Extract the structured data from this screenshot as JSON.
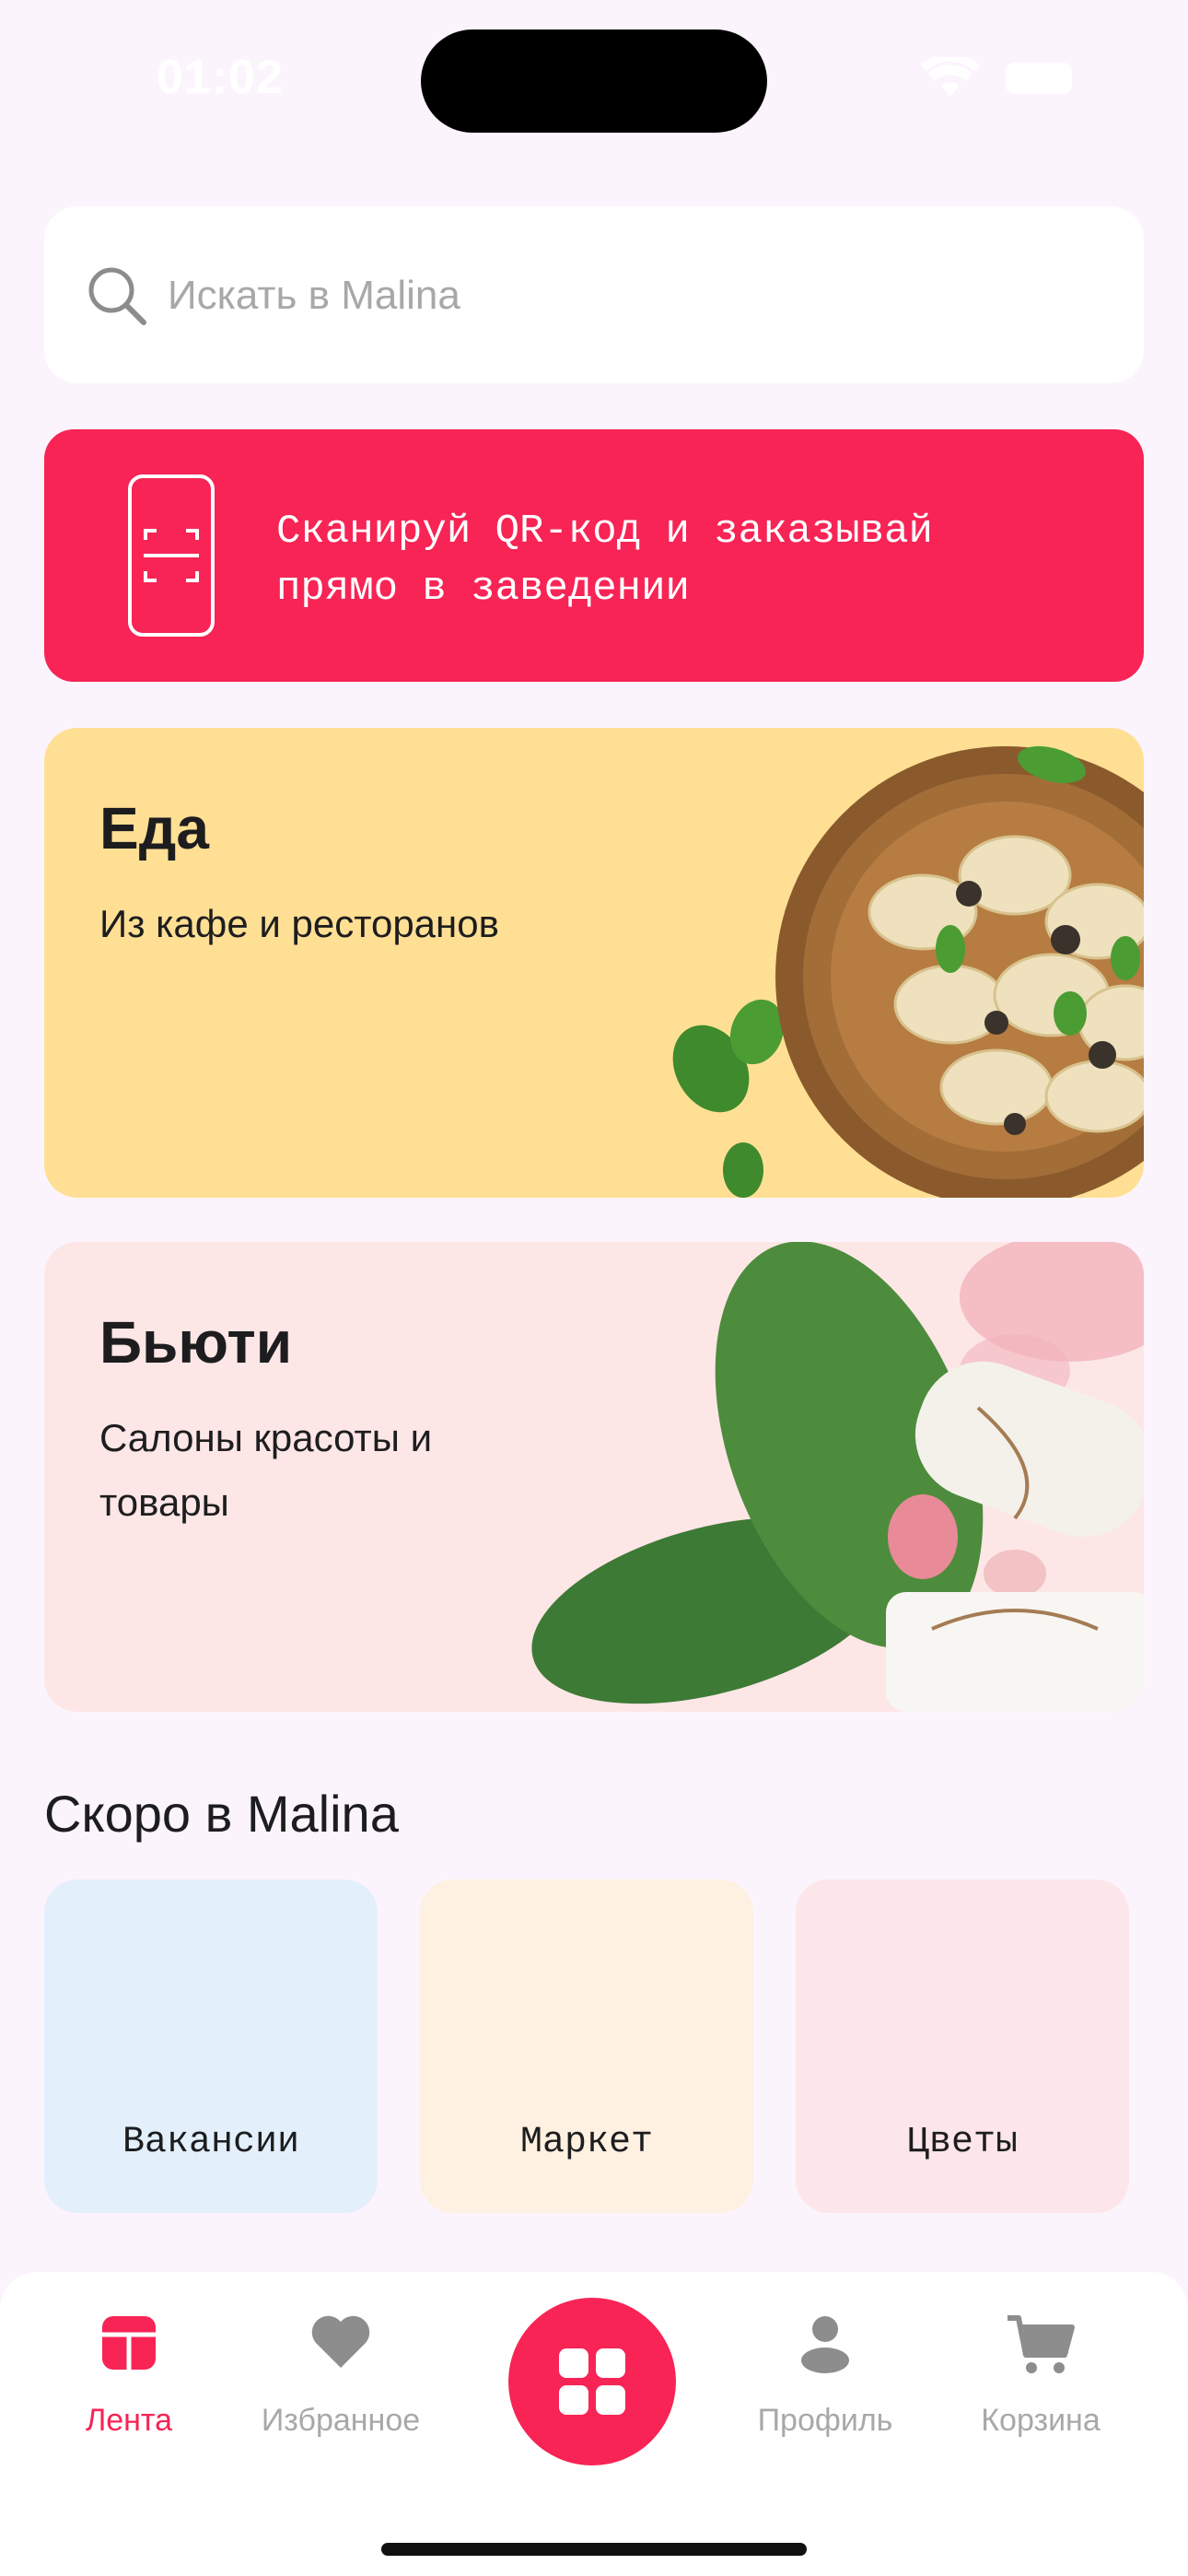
{
  "status_bar": {
    "time": "01:02"
  },
  "search": {
    "placeholder": "Искать в Malina"
  },
  "qr_banner": {
    "text": "Сканируй QR-код и заказывай\nпрямо в заведении"
  },
  "categories": [
    {
      "title": "Еда",
      "subtitle": "Из кафе и ресторанов",
      "color": "#ffdf94"
    },
    {
      "title": "Бьюти",
      "subtitle": "Салоны красоты и товары",
      "color": "#fde6e6"
    }
  ],
  "soon": {
    "title": "Скоро в Malina",
    "items": [
      {
        "label": "Вакансии",
        "color": "#e3f0fc"
      },
      {
        "label": "Маркет",
        "color": "#fff1e1"
      },
      {
        "label": "Цветы",
        "color": "#fce6ea"
      }
    ]
  },
  "tabbar": {
    "items": [
      {
        "label": "Лента",
        "icon": "feed-icon",
        "active": true
      },
      {
        "label": "Избранное",
        "icon": "heart-icon"
      },
      {
        "label": "",
        "icon": "grid-icon"
      },
      {
        "label": "Профиль",
        "icon": "profile-icon"
      },
      {
        "label": "Корзина",
        "icon": "cart-icon"
      }
    ]
  },
  "colors": {
    "accent": "#f72455",
    "background": "#fcf4fd"
  }
}
